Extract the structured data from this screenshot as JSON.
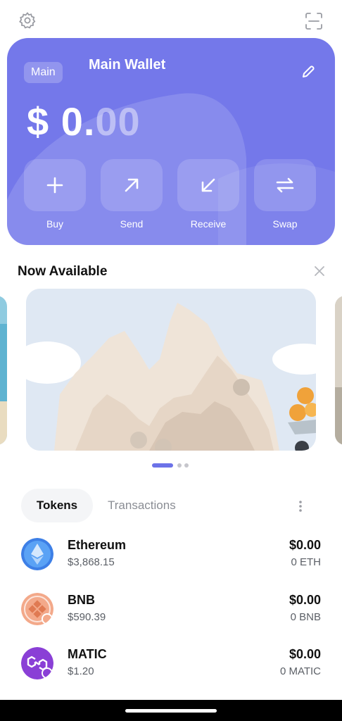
{
  "header": {
    "settings_icon": "gear-icon",
    "scan_icon": "scan-icon"
  },
  "wallet_card": {
    "badge": "Main",
    "title": "Main Wallet",
    "balance_whole": "$ 0.",
    "balance_decimal": "00",
    "accent": "#7478ea",
    "actions": [
      {
        "label": "Buy",
        "icon": "plus-icon"
      },
      {
        "label": "Send",
        "icon": "arrow-up-right-icon"
      },
      {
        "label": "Receive",
        "icon": "arrow-down-left-icon"
      },
      {
        "label": "Swap",
        "icon": "swap-icon"
      }
    ]
  },
  "promo": {
    "heading": "Now Available",
    "carousel_count": 3,
    "carousel_active": 1
  },
  "tabs": {
    "active": "Tokens",
    "inactive": "Transactions"
  },
  "tokens": [
    {
      "name": "Ethereum",
      "price": "$3,868.15",
      "value": "$0.00",
      "amount": "0 ETH",
      "color": "#4c8ff0"
    },
    {
      "name": "BNB",
      "price": "$590.39",
      "value": "$0.00",
      "amount": "0 BNB",
      "color": "#f4ad8e"
    },
    {
      "name": "MATIC",
      "price": "$1.20",
      "value": "$0.00",
      "amount": "0 MATIC",
      "color": "#8a3fd6"
    }
  ]
}
